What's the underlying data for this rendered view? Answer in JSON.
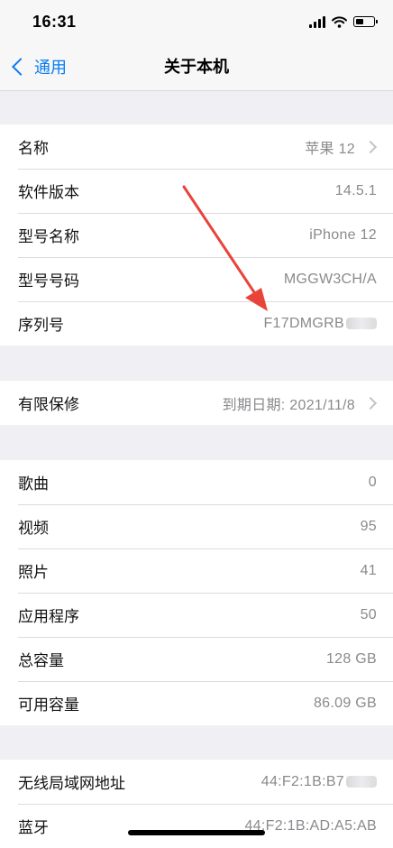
{
  "status_bar": {
    "time": "16:31"
  },
  "nav": {
    "back_label": "通用",
    "title": "关于本机"
  },
  "group1": [
    {
      "label": "名称",
      "value": "苹果 12",
      "chevron": true
    },
    {
      "label": "软件版本",
      "value": "14.5.1"
    },
    {
      "label": "型号名称",
      "value": "iPhone 12"
    },
    {
      "label": "型号号码",
      "value": "MGGW3CH/A"
    },
    {
      "label": "序列号",
      "value": "F17DMGRB",
      "masked": true
    }
  ],
  "group2": [
    {
      "label": "有限保修",
      "value": "到期日期: 2021/11/8",
      "chevron": true
    }
  ],
  "group3": [
    {
      "label": "歌曲",
      "value": "0"
    },
    {
      "label": "视频",
      "value": "95"
    },
    {
      "label": "照片",
      "value": "41"
    },
    {
      "label": "应用程序",
      "value": "50"
    },
    {
      "label": "总容量",
      "value": "128 GB"
    },
    {
      "label": "可用容量",
      "value": "86.09 GB"
    }
  ],
  "group4": [
    {
      "label": "无线局域网地址",
      "value": "44:F2:1B:B7",
      "masked": true
    },
    {
      "label": "蓝牙",
      "value": "44:F2:1B:AD:A5:AB"
    }
  ],
  "colors": {
    "accent": "#0a7cf2",
    "annotation_arrow": "#e8443a",
    "secondary_text": "#8a8a8e"
  }
}
